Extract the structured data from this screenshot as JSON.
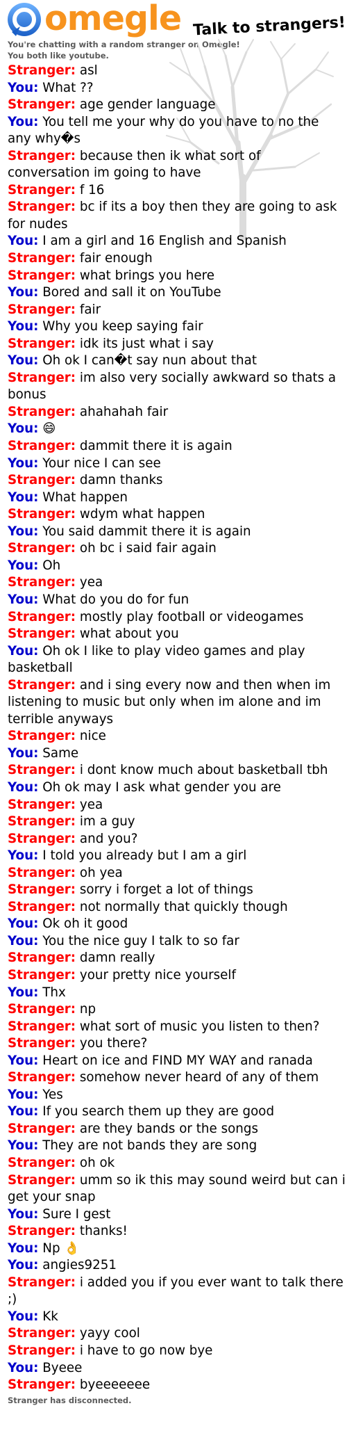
{
  "brand": {
    "name": "omegle",
    "tagline": "Talk to strangers!",
    "color": "#f7931e"
  },
  "intro": {
    "line1": "You're chatting with a random stranger on Omegle!",
    "line2": "You both like youtube."
  },
  "speakers": {
    "stranger": "Stranger:",
    "you": "You:",
    "stranger_color": "#ff0000",
    "you_color": "#0000cc"
  },
  "messages": [
    {
      "who": "stranger",
      "text": "asl"
    },
    {
      "who": "you",
      "text": "What ??"
    },
    {
      "who": "stranger",
      "text": "age gender language"
    },
    {
      "who": "you",
      "text": "You tell me your why do you have to no the any why�s"
    },
    {
      "who": "stranger",
      "text": "because then ik what sort of conversation im going to have"
    },
    {
      "who": "stranger",
      "text": "f 16"
    },
    {
      "who": "stranger",
      "text": "bc if its a boy then they are going to ask for nudes"
    },
    {
      "who": "you",
      "text": "I am a girl and 16 English and Spanish"
    },
    {
      "who": "stranger",
      "text": "fair enough"
    },
    {
      "who": "stranger",
      "text": "what brings you here"
    },
    {
      "who": "you",
      "text": "Bored and sall it on YouTube"
    },
    {
      "who": "stranger",
      "text": "fair"
    },
    {
      "who": "you",
      "text": "Why you keep saying fair"
    },
    {
      "who": "stranger",
      "text": "idk its just what i say"
    },
    {
      "who": "you",
      "text": "Oh ok I can�t say nun about that"
    },
    {
      "who": "stranger",
      "text": "im also very socially awkward so thats a bonus"
    },
    {
      "who": "stranger",
      "text": "ahahahah fair"
    },
    {
      "who": "you",
      "text": "😄"
    },
    {
      "who": "stranger",
      "text": "dammit there it is again"
    },
    {
      "who": "you",
      "text": "Your nice I can see"
    },
    {
      "who": "stranger",
      "text": "damn thanks"
    },
    {
      "who": "you",
      "text": "What happen"
    },
    {
      "who": "stranger",
      "text": "wdym what happen"
    },
    {
      "who": "you",
      "text": "You said dammit there it is again"
    },
    {
      "who": "stranger",
      "text": "oh bc i said fair again"
    },
    {
      "who": "you",
      "text": "Oh"
    },
    {
      "who": "stranger",
      "text": "yea"
    },
    {
      "who": "you",
      "text": "What do you do for fun"
    },
    {
      "who": "stranger",
      "text": "mostly play football or videogames"
    },
    {
      "who": "stranger",
      "text": "what about you"
    },
    {
      "who": "you",
      "text": "Oh ok  I like to play video games and play basketball"
    },
    {
      "who": "stranger",
      "text": "and i sing every now and then when im listening to music but only when im alone and im terrible anyways"
    },
    {
      "who": "stranger",
      "text": "nice"
    },
    {
      "who": "you",
      "text": "Same"
    },
    {
      "who": "stranger",
      "text": "i dont know much about basketball tbh"
    },
    {
      "who": "you",
      "text": "Oh ok may I ask what gender you are"
    },
    {
      "who": "stranger",
      "text": "yea"
    },
    {
      "who": "stranger",
      "text": "im a guy"
    },
    {
      "who": "stranger",
      "text": "and you?"
    },
    {
      "who": "you",
      "text": "I told you already but I am a girl"
    },
    {
      "who": "stranger",
      "text": "oh yea"
    },
    {
      "who": "stranger",
      "text": "sorry i forget a lot of things"
    },
    {
      "who": "stranger",
      "text": "not normally that quickly though"
    },
    {
      "who": "you",
      "text": "Ok oh it good"
    },
    {
      "who": "you",
      "text": "You the nice guy I talk to so far"
    },
    {
      "who": "stranger",
      "text": "damn really"
    },
    {
      "who": "stranger",
      "text": "your pretty nice yourself"
    },
    {
      "who": "you",
      "text": "Thx"
    },
    {
      "who": "stranger",
      "text": "np"
    },
    {
      "who": "stranger",
      "text": "what sort of music you listen to then?"
    },
    {
      "who": "stranger",
      "text": "you there?"
    },
    {
      "who": "you",
      "text": "Heart on ice and FIND MY WAY and ranada"
    },
    {
      "who": "stranger",
      "text": "somehow never heard of any of them"
    },
    {
      "who": "you",
      "text": "Yes"
    },
    {
      "who": "you",
      "text": "If you search them up they are good"
    },
    {
      "who": "stranger",
      "text": "are they bands or the songs"
    },
    {
      "who": "you",
      "text": "They are not bands they are song"
    },
    {
      "who": "stranger",
      "text": "oh ok"
    },
    {
      "who": "stranger",
      "text": "umm so ik this may sound weird but can i get your snap"
    },
    {
      "who": "you",
      "text": "Sure I gest"
    },
    {
      "who": "stranger",
      "text": "thanks!"
    },
    {
      "who": "you",
      "text": "Np 👌"
    },
    {
      "who": "you",
      "text": "angies9251"
    },
    {
      "who": "stranger",
      "text": "i added you if you ever want to talk there ;)"
    },
    {
      "who": "you",
      "text": "Kk"
    },
    {
      "who": "stranger",
      "text": "yayy cool"
    },
    {
      "who": "stranger",
      "text": "i have to go now bye"
    },
    {
      "who": "you",
      "text": "Byeee"
    },
    {
      "who": "stranger",
      "text": "byeeeeeee"
    }
  ],
  "status": "Stranger has disconnected."
}
